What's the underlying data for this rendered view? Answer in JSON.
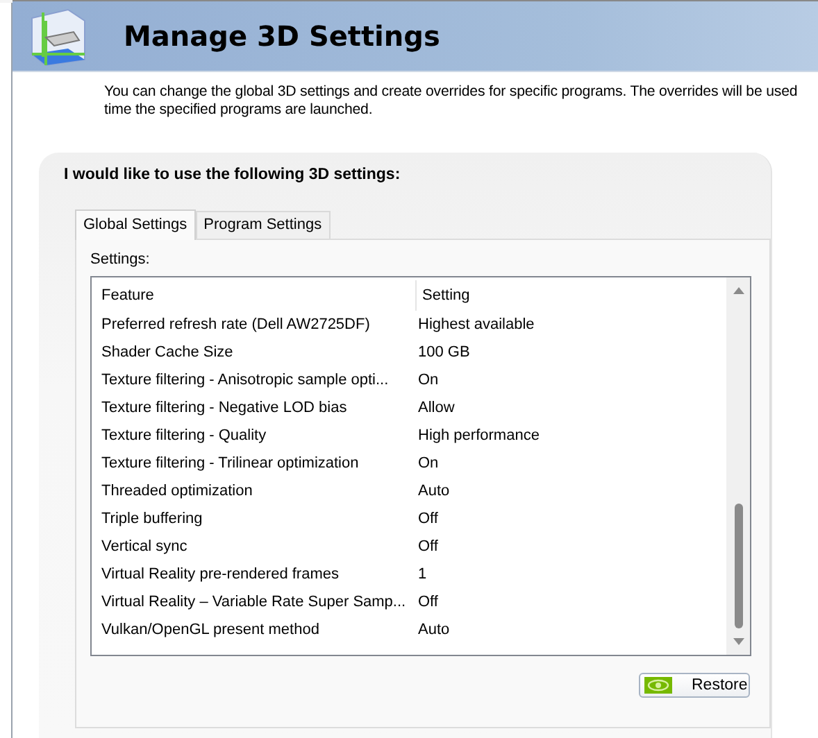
{
  "header": {
    "title": "Manage 3D Settings"
  },
  "description_lines": [
    "You can change the global 3D settings and create overrides for specific programs. The overrides will be used",
    "time the specified programs are launched."
  ],
  "panel": {
    "heading": "I would like to use the following 3D settings:",
    "tabs": [
      {
        "label": "Global Settings",
        "selected": true
      },
      {
        "label": "Program Settings",
        "selected": false
      }
    ],
    "settings_label": "Settings:",
    "table": {
      "columns": [
        "Feature",
        "Setting"
      ],
      "rows": [
        {
          "feature": "Preferred refresh rate (Dell AW2725DF)",
          "setting": "Highest available"
        },
        {
          "feature": "Shader Cache Size",
          "setting": "100 GB"
        },
        {
          "feature": "Texture filtering - Anisotropic sample opti...",
          "setting": "On"
        },
        {
          "feature": "Texture filtering - Negative LOD bias",
          "setting": "Allow"
        },
        {
          "feature": "Texture filtering - Quality",
          "setting": "High performance"
        },
        {
          "feature": "Texture filtering - Trilinear optimization",
          "setting": "On"
        },
        {
          "feature": "Threaded optimization",
          "setting": "Auto"
        },
        {
          "feature": "Triple buffering",
          "setting": "Off"
        },
        {
          "feature": "Vertical sync",
          "setting": "Off"
        },
        {
          "feature": "Virtual Reality pre-rendered frames",
          "setting": "1"
        },
        {
          "feature": "Virtual Reality – Variable Rate Super Samp...",
          "setting": "Off"
        },
        {
          "feature": "Vulkan/OpenGL present method",
          "setting": "Auto"
        }
      ]
    },
    "restore_button": "Restore"
  }
}
